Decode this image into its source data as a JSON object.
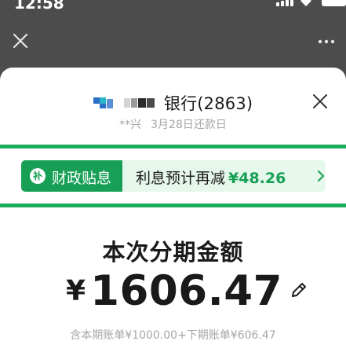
{
  "status_bar": {
    "time": "12:58",
    "signal_icon": "cellular-signal-icon",
    "wifi_icon": "wifi-icon",
    "battery_icon": "battery-icon"
  },
  "nav": {
    "close_icon": "close-icon",
    "more_icon": "more-icon"
  },
  "sheet": {
    "bank": {
      "logo_icon": "bank-logo-icon",
      "masked": true,
      "name": "银行(2863)"
    },
    "close_icon": "close-icon",
    "due": {
      "holder": "**兴",
      "date_text": "3月28日还款日"
    },
    "promo": {
      "tag_icon_char": "补",
      "tag_label": "财政贴息",
      "text": "利息预计再减",
      "amount": "¥48.26",
      "arrow_icon": "chevron-right-icon"
    },
    "amount": {
      "title": "本次分期金额",
      "currency": "¥",
      "value": "1606.47",
      "edit_icon": "pencil-icon"
    },
    "breakdown": "含本期账单¥1000.00+下期账单¥606.47"
  },
  "colors": {
    "overlay": "#4c4c4c",
    "brand_green": "#17a055",
    "promo_bg": "#e6f7ec",
    "text_primary": "#1a1a1a",
    "text_secondary": "#a6a6a6"
  }
}
